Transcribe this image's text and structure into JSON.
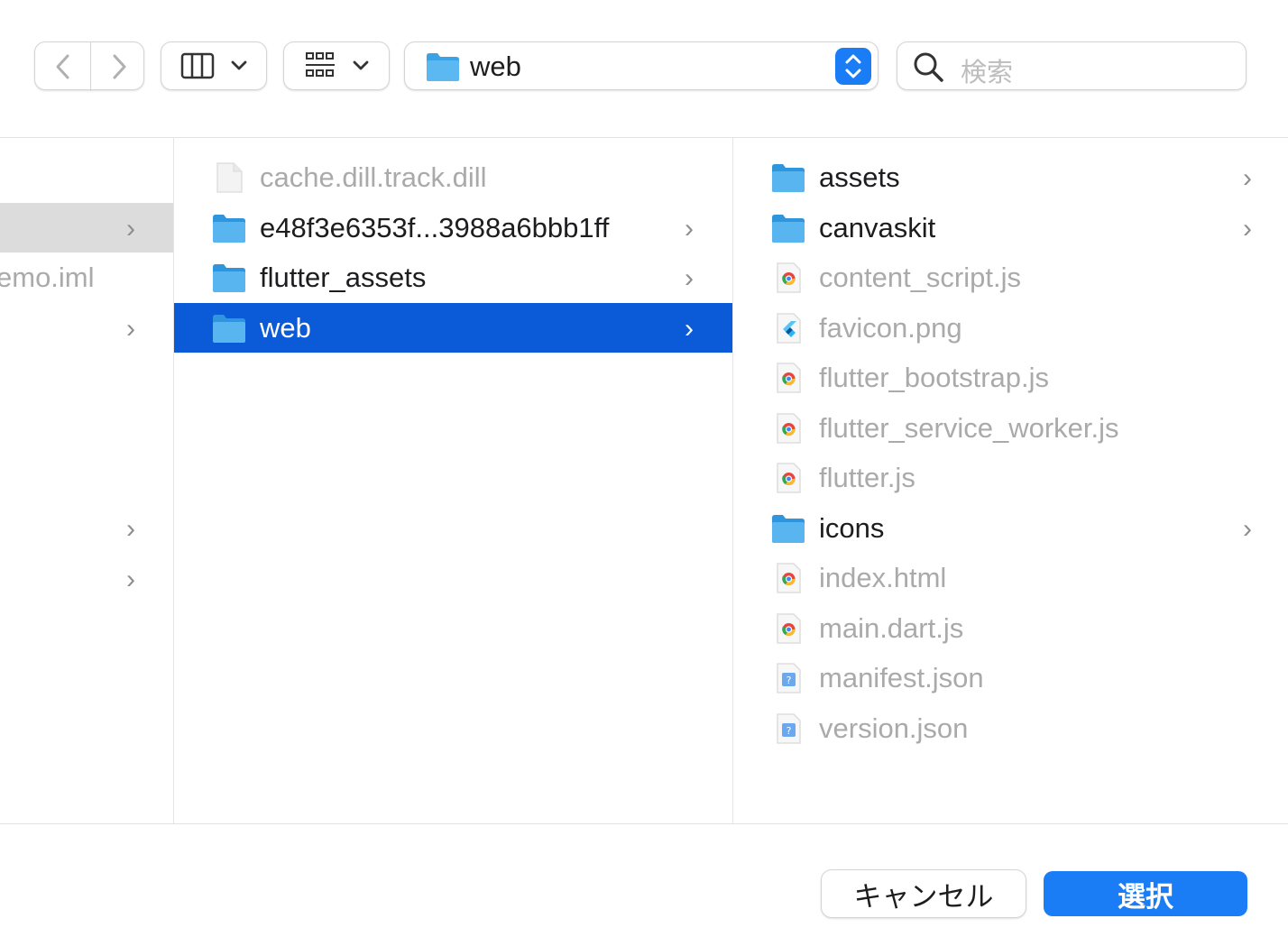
{
  "toolbar": {
    "view_column_icon": "column-view-icon",
    "view_group_icon": "group-view-icon",
    "path_folder": "web",
    "search_placeholder": "検索"
  },
  "columns": {
    "first": {
      "items": [
        {
          "label": "",
          "chevron": true,
          "selected": "gray"
        },
        {
          "label": "emo.iml",
          "chevron": false
        },
        {
          "label": "",
          "chevron": true
        },
        {
          "label": "",
          "chevron": true
        },
        {
          "label": "",
          "chevron": true
        }
      ]
    },
    "second": {
      "items": [
        {
          "label": "cache.dill.track.dill",
          "icon": "file",
          "dim": true,
          "chevron": false
        },
        {
          "label": "e48f3e6353f...3988a6bbb1ff",
          "icon": "folder",
          "chevron": true
        },
        {
          "label": "flutter_assets",
          "icon": "folder",
          "chevron": true
        },
        {
          "label": "web",
          "icon": "folder",
          "chevron": true,
          "selected": true
        }
      ]
    },
    "third": {
      "items": [
        {
          "label": "assets",
          "icon": "folder",
          "chevron": true
        },
        {
          "label": "canvaskit",
          "icon": "folder",
          "chevron": true
        },
        {
          "label": "content_script.js",
          "icon": "chrome-file",
          "dim": true
        },
        {
          "label": "favicon.png",
          "icon": "flutter-image",
          "dim": true
        },
        {
          "label": "flutter_bootstrap.js",
          "icon": "chrome-file",
          "dim": true
        },
        {
          "label": "flutter_service_worker.js",
          "icon": "chrome-file",
          "dim": true
        },
        {
          "label": "flutter.js",
          "icon": "chrome-file",
          "dim": true
        },
        {
          "label": "icons",
          "icon": "folder",
          "chevron": true
        },
        {
          "label": "index.html",
          "icon": "chrome-file",
          "dim": true
        },
        {
          "label": "main.dart.js",
          "icon": "chrome-file",
          "dim": true
        },
        {
          "label": "manifest.json",
          "icon": "json-file",
          "dim": true
        },
        {
          "label": "version.json",
          "icon": "json-file",
          "dim": true
        }
      ]
    }
  },
  "footer": {
    "cancel_label": "キャンセル",
    "select_label": "選択"
  },
  "colors": {
    "accent": "#1b7df6",
    "selection": "#0b5bd8",
    "folder": "#3aa3e6"
  }
}
